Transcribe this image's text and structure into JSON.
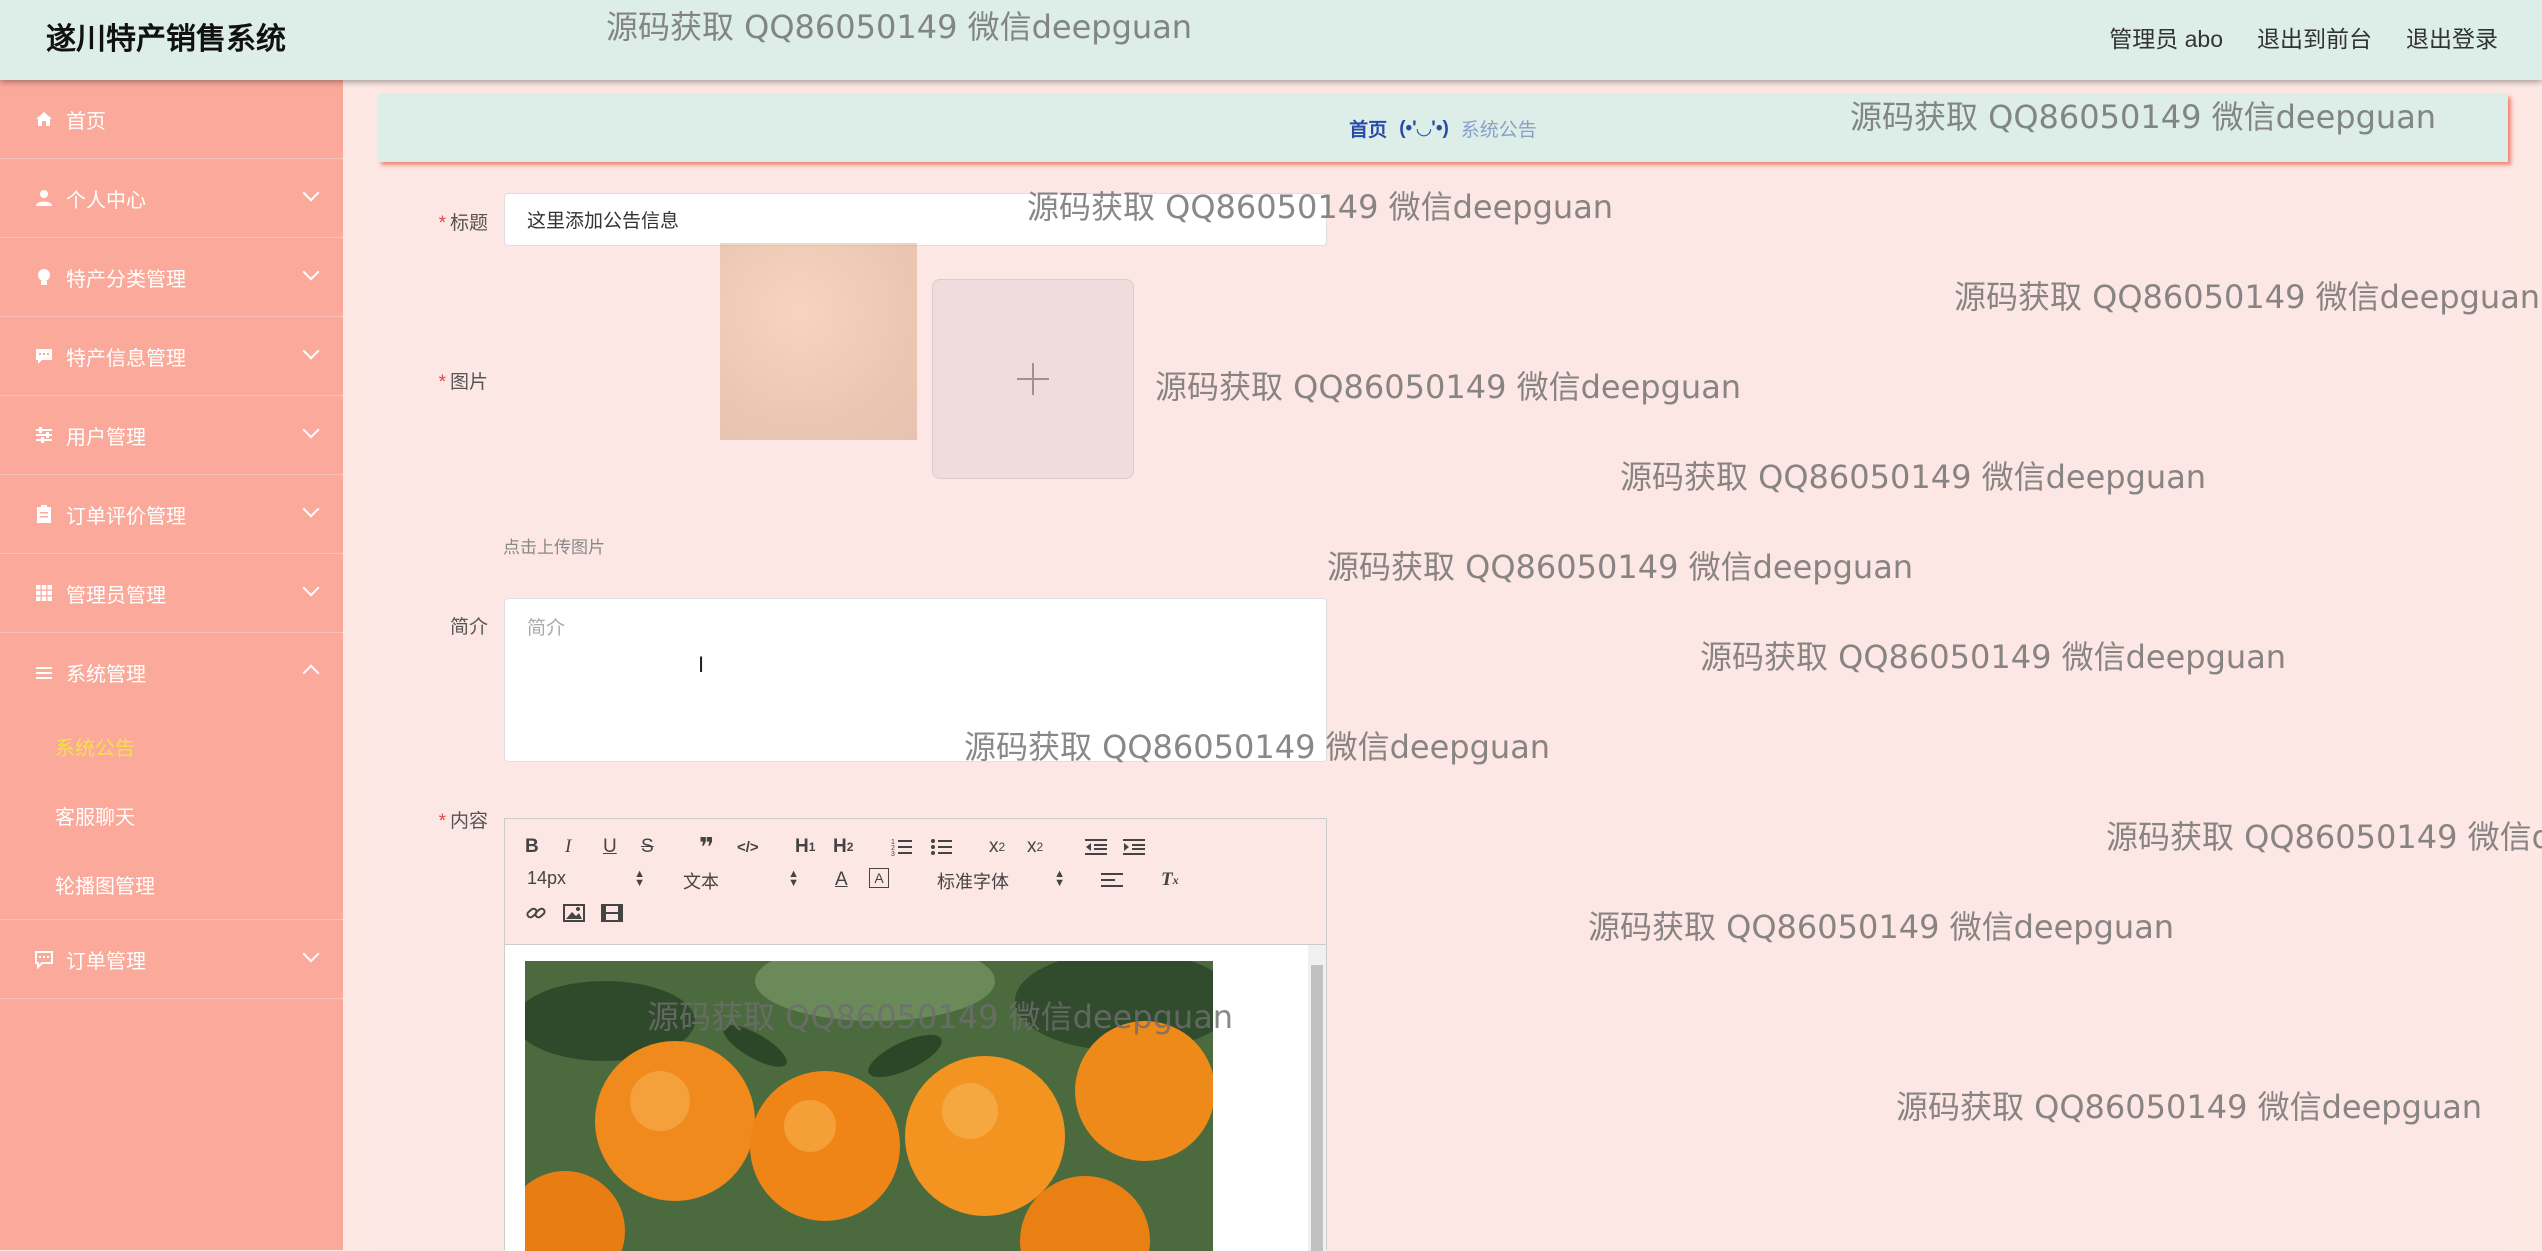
{
  "header": {
    "brand": "遂川特产销售系统",
    "admin_label": "管理员 abo",
    "front_label": "退出到前台",
    "logout_label": "退出登录"
  },
  "sidebar": {
    "items": [
      {
        "label": "首页",
        "icon": "home-icon"
      },
      {
        "label": "个人中心",
        "icon": "user-icon"
      },
      {
        "label": "特产分类管理",
        "icon": "bulb-icon"
      },
      {
        "label": "特产信息管理",
        "icon": "chat-icon"
      },
      {
        "label": "用户管理",
        "icon": "sliders-icon"
      },
      {
        "label": "订单评价管理",
        "icon": "clipboard-icon"
      },
      {
        "label": "管理员管理",
        "icon": "grid-icon"
      },
      {
        "label": "系统管理",
        "icon": "list-icon"
      }
    ],
    "sub_items": [
      {
        "label": "系统公告"
      },
      {
        "label": "客服聊天"
      },
      {
        "label": "轮播图管理"
      }
    ],
    "last_item": {
      "label": "订单管理",
      "icon": "message-icon"
    }
  },
  "breadcrumb": {
    "home": "首页",
    "face": "(•'◡'•)",
    "current": "系统公告"
  },
  "form": {
    "title_label": "标题",
    "title_value": "这里添加公告信息",
    "image_label": "图片",
    "upload_hint": "点击上传图片",
    "intro_label": "简介",
    "intro_placeholder": "简介",
    "content_label": "内容"
  },
  "editor": {
    "font_size": "14px",
    "header_select": "文本",
    "font_family": "标准字体"
  },
  "watermark": "源码获取 QQ86050149 微信deepguan",
  "accent_colors": {
    "sidebar": "#fba99a",
    "header": "#dceee7",
    "active_sub": "#f5e04a",
    "required": "#e04848"
  }
}
